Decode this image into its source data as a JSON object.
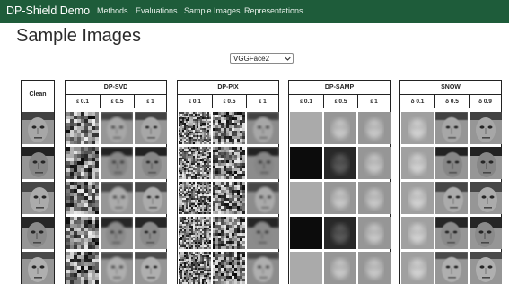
{
  "navbar": {
    "brand": "DP-Shield Demo",
    "links": [
      "Methods",
      "Evaluations",
      "Sample Images",
      "Representations"
    ]
  },
  "page": {
    "title": "Sample Images"
  },
  "dataset_select": {
    "value": "VGGFace2"
  },
  "table": {
    "clean_label": "Clean",
    "methods": [
      {
        "name": "DP-SVD",
        "params": [
          "ε 0.1",
          "ε 0.5",
          "ε 1"
        ]
      },
      {
        "name": "DP-PIX",
        "params": [
          "ε 0.1",
          "ε 0.5",
          "ε 1"
        ]
      },
      {
        "name": "DP-SAMP",
        "params": [
          "ε 0.1",
          "ε 0.5",
          "ε 1"
        ]
      },
      {
        "name": "SNOW",
        "params": [
          "δ 0.1",
          "δ 0.5",
          "δ 0.9"
        ]
      }
    ],
    "row_count": 5
  }
}
